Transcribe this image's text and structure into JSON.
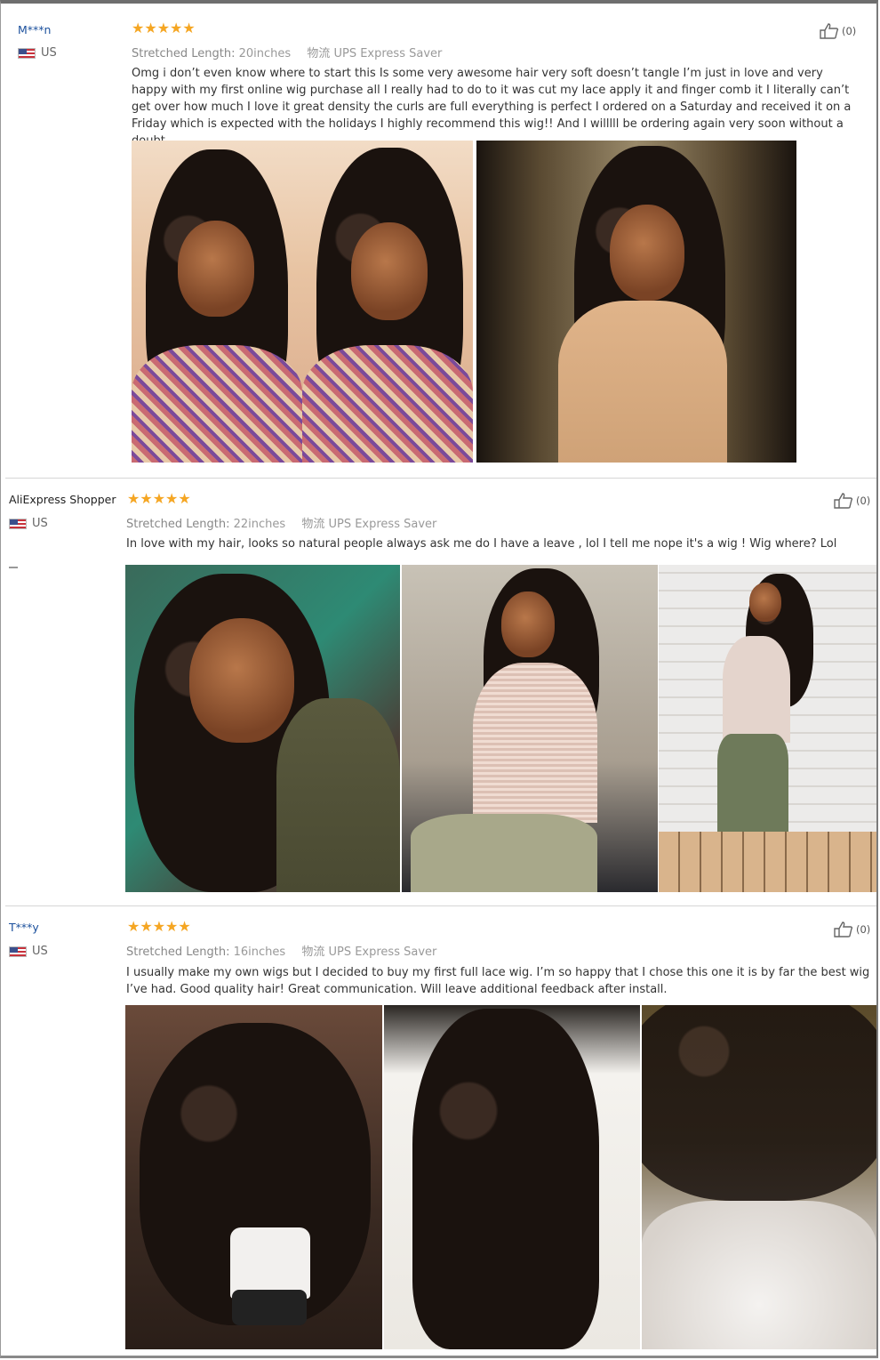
{
  "reviews": [
    {
      "user": "M***n",
      "country": "US",
      "stars": "★★★★★",
      "length_label": "Stretched Length:",
      "length_value": "20inches",
      "shipping": "物流 UPS Express Saver",
      "likes": "(0)",
      "text": "Omg i don’t even know where to start this Is some very awesome hair very soft doesn’t tangle I’m just in love and very happy with my first online wig purchase all I really had to do to it was cut my lace apply it and finger comb it I literally can’t get over how much I love it great density the curls are full everything is perfect I ordered on a Saturday and received it on a Friday which is expected with the holidays I highly recommend this wig!! And I willlll be ordering again very soon without a doubt",
      "photos": [
        "photo-selfie-pink-top",
        "photo-selfie-tongue-out",
        "photo-selfie-beige-top"
      ]
    },
    {
      "user": "AliExpress Shopper",
      "country": "US",
      "stars": "★★★★★",
      "length_label": "Stretched Length:",
      "length_value": "22inches",
      "shipping": "物流 UPS Express Saver",
      "likes": "(0)",
      "text": "In love with my hair, looks so natural people always ask me do I have a leave , lol I tell me nope it's a wig ! Wig where? Lol",
      "photos": [
        "photo-smiling-selfie",
        "photo-office-pose",
        "photo-full-body"
      ]
    },
    {
      "user": "T***y",
      "country": "US",
      "stars": "★★★★★",
      "length_label": "Stretched Length:",
      "length_value": "16inches",
      "shipping": "物流 UPS Express Saver",
      "likes": "(0)",
      "text": "I usually make my own wigs but I decided to buy my first full lace wig. I’m so happy that I chose this one it is by far the best wig I’ve had. Good quality hair! Great communication. Will leave additional feedback after install.",
      "photos": [
        "photo-wig-on-mannequin",
        "photo-wig-in-box",
        "photo-lace-closeup"
      ]
    }
  ],
  "colors": {
    "star": "#f5a623",
    "username": "#1a4f9c",
    "divider": "#d6d6d6"
  },
  "icons": {
    "like": "thumbs-up-icon",
    "flag": "us-flag-icon",
    "star": "star-icon"
  }
}
